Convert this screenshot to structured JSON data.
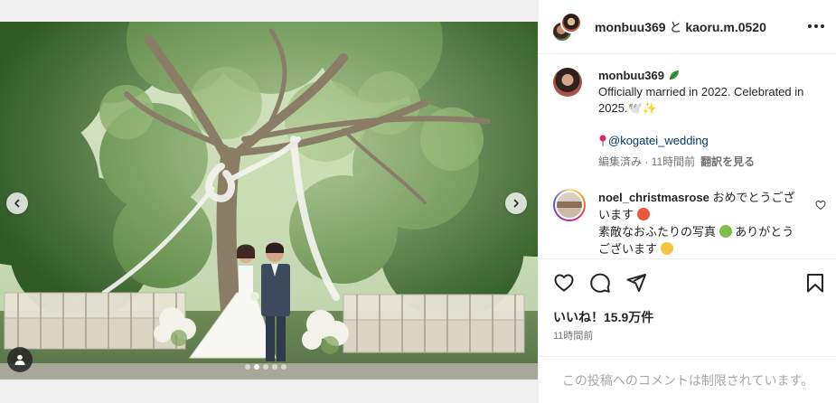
{
  "header": {
    "user1": "monbuu369",
    "joiner": " と ",
    "user2": "kaoru.m.0520"
  },
  "caption": {
    "username": "monbuu369",
    "text": "Officially married in 2022. Celebrated in 2025.🕊️✨",
    "location_mention": "@kogatei_wedding",
    "edited_time": "編集済み · 11時間前",
    "translate": "翻訳を見る"
  },
  "comment": {
    "username": "noel_christmasrose",
    "text_part1": " おめでとうございます",
    "text_part2": "素敵なおふたりの写真",
    "text_part3": "ありがとうございます"
  },
  "post": {
    "likes": "いいね！15.9万件",
    "time": "11時間前",
    "comments_restricted": "この投稿へのコメントは制限されています。"
  },
  "carousel": {
    "slide_count": 5,
    "current_index": 2
  },
  "colors": {
    "accent": "#0095f6",
    "mention": "#00376b",
    "muted": "#737373",
    "foliage": "#3f6b2e"
  },
  "icons": {
    "more": "more-horizontal-icon",
    "like": "heart-icon",
    "comment": "comment-bubble-icon",
    "share": "paper-plane-icon",
    "save": "bookmark-icon",
    "tag": "user-tag-icon",
    "prev": "chevron-left-icon",
    "next": "chevron-right-icon"
  }
}
